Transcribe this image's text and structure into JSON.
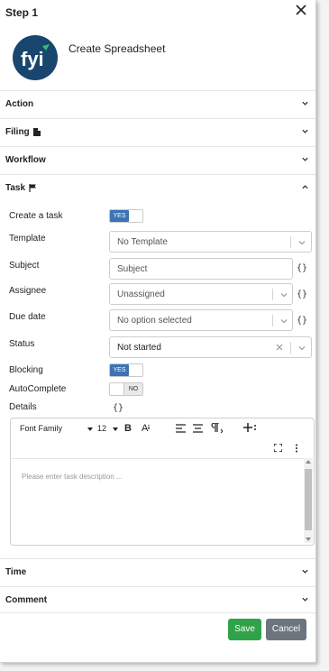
{
  "header": {
    "title": "Step 1"
  },
  "app": {
    "logo_text": "fyi",
    "name": "Create Spreadsheet"
  },
  "sections": {
    "action": "Action",
    "filing": "Filing",
    "workflow": "Workflow",
    "task": "Task",
    "time": "Time",
    "comment": "Comment"
  },
  "task": {
    "create_task": {
      "label": "Create a task",
      "toggle": "YES"
    },
    "template": {
      "label": "Template",
      "value": "No Template"
    },
    "subject": {
      "label": "Subject",
      "placeholder": "Subject"
    },
    "assignee": {
      "label": "Assignee",
      "value": "Unassigned"
    },
    "due_date": {
      "label": "Due date",
      "value": "No option selected"
    },
    "status": {
      "label": "Status",
      "value": "Not started"
    },
    "blocking": {
      "label": "Blocking",
      "toggle": "YES"
    },
    "autocomplete": {
      "label": "AutoComplete",
      "toggle": "NO"
    },
    "details": {
      "label": "Details"
    },
    "variable_glyph": "{}"
  },
  "editor": {
    "font_family": "Font Family",
    "font_size": "12",
    "bold": "B",
    "font_color": "A",
    "placeholder": "Please enter task description ..."
  },
  "footer": {
    "save": "Save",
    "cancel": "Cancel"
  },
  "colors": {
    "primary": "#3a73b6",
    "save": "#2fa24a",
    "cancel": "#6c757d",
    "logo_bg": "#19466e",
    "logo_accent": "#2fbf7a"
  }
}
